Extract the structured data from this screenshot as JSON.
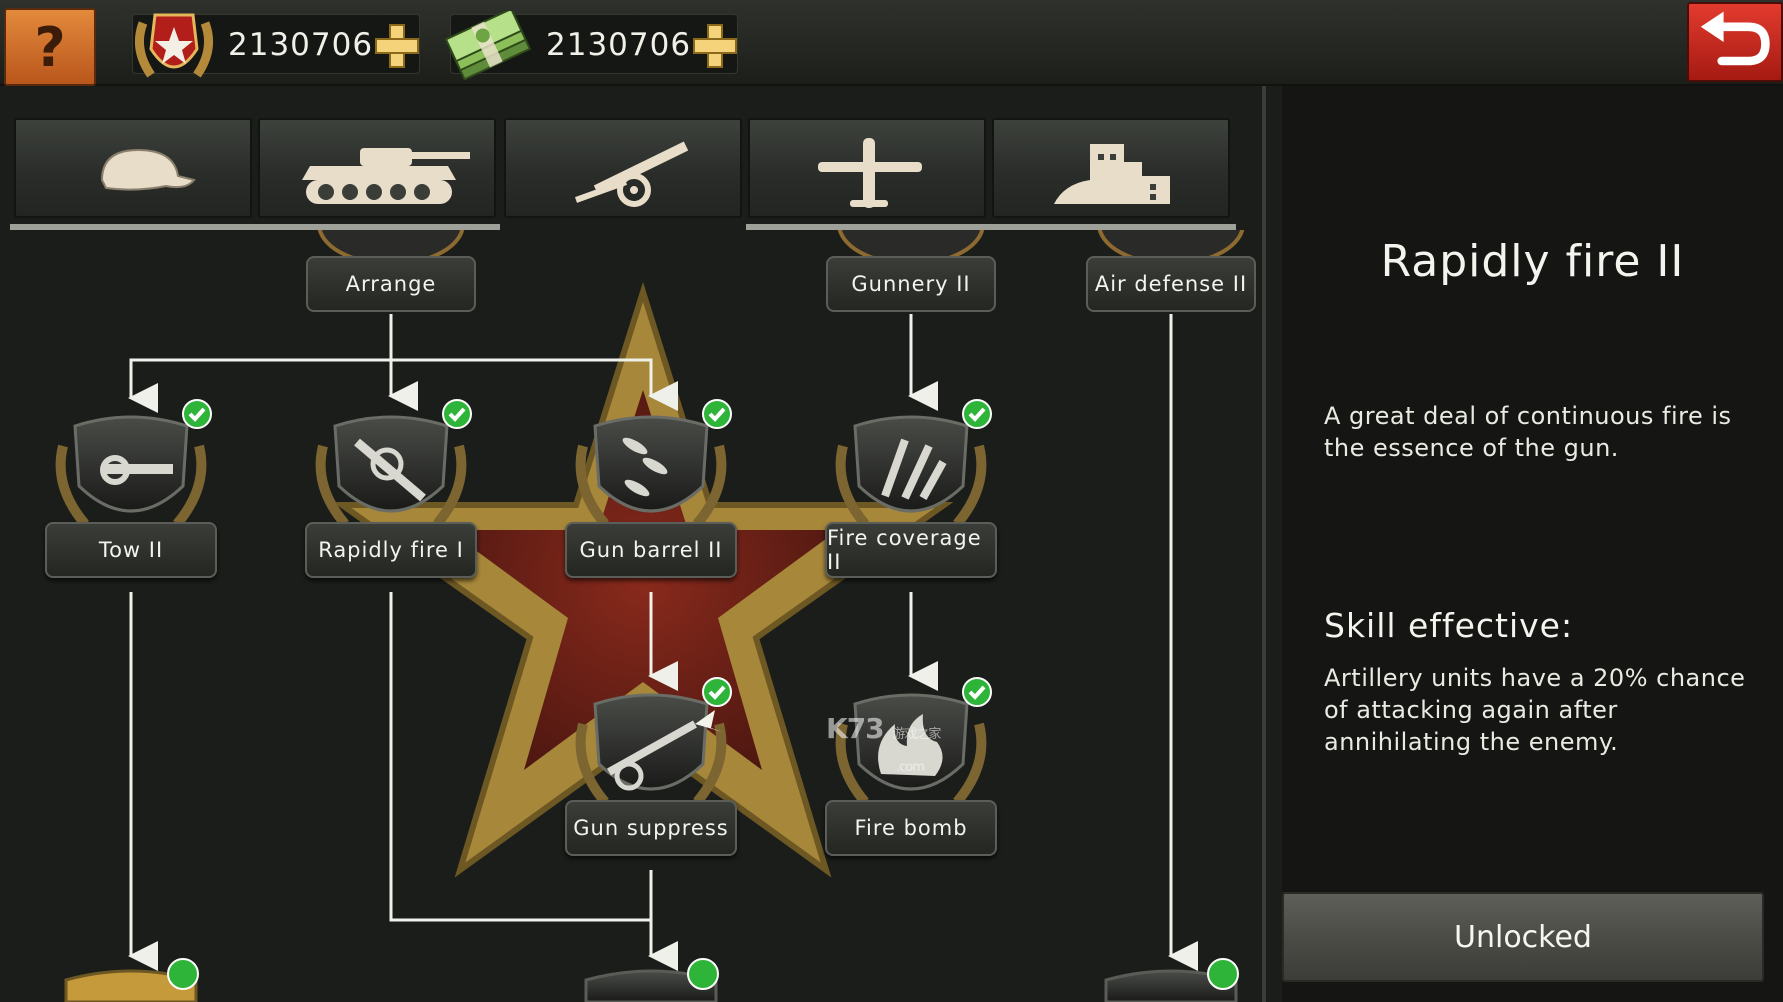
{
  "header": {
    "help_label": "?",
    "medal_count": "2130706",
    "cash_count": "2130706"
  },
  "tabs": [
    {
      "name": "infantry",
      "icon": "helmet-icon"
    },
    {
      "name": "armor",
      "icon": "tank-icon"
    },
    {
      "name": "artillery",
      "icon": "artillery-cannon-icon"
    },
    {
      "name": "air",
      "icon": "airplane-icon"
    },
    {
      "name": "navy",
      "icon": "warship-icon"
    }
  ],
  "tree": {
    "top_labels": [
      "Arrange",
      "Gunnery II",
      "Air defense II"
    ],
    "nodes": [
      {
        "label": "Tow II",
        "icon": "tow-hook-icon",
        "unlocked": true
      },
      {
        "label": "Rapidly fire I",
        "icon": "rapid-fire-cannon-icon",
        "unlocked": true
      },
      {
        "label": "Gun barrel II",
        "icon": "shells-icon",
        "unlocked": true
      },
      {
        "label": "Fire coverage II",
        "icon": "rockets-icon",
        "unlocked": true
      },
      {
        "label": "Gun suppress",
        "icon": "field-gun-icon",
        "unlocked": true
      },
      {
        "label": "Fire bomb",
        "icon": "flame-icon",
        "unlocked": true
      }
    ]
  },
  "watermark": {
    "main": "K73",
    "sub": "游戏之家",
    "domain": ".com"
  },
  "panel": {
    "title": "Rapidly fire II",
    "description": "A great deal of continuous fire is the essence of the gun.",
    "effect_heading": "Skill effective:",
    "effect_text": "Artillery units have a 20% chance of attacking again after annihilating the enemy.",
    "button_label": "Unlocked"
  },
  "colors": {
    "accent_red": "#c8281c",
    "help_orange": "#d9782f",
    "check_green": "#2fb43a",
    "star_gold": "#a7873a"
  }
}
